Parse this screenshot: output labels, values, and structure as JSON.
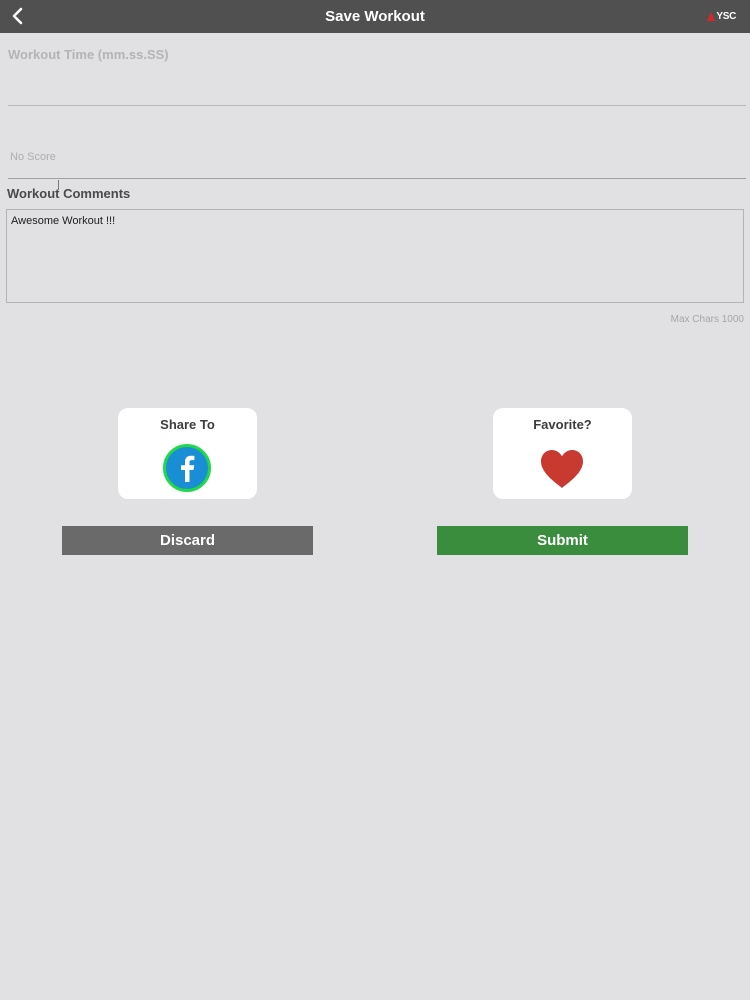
{
  "header": {
    "title": "Save Workout",
    "logo_text": "YSC",
    "back_icon": "chevron-left-icon",
    "logo_accent": "#d8262b",
    "bar_color": "#505050"
  },
  "form": {
    "workout_time_label": "Workout Time (mm.ss.SS)",
    "score_placeholder": "No Score",
    "comments_label": "Workout Comments",
    "comments_value": "Awesome Workout !!!",
    "max_chars_text": "Max Chars 1000"
  },
  "share": {
    "label": "Share To",
    "icon": "facebook-icon",
    "icon_color": "#1a8ed4",
    "ring_color": "#22d84a"
  },
  "favorite": {
    "label": "Favorite?",
    "icon": "heart-icon",
    "icon_color": "#c83a30"
  },
  "actions": {
    "discard_label": "Discard",
    "submit_label": "Submit",
    "discard_color": "#6a6a6a",
    "submit_color": "#3a8d3d"
  }
}
